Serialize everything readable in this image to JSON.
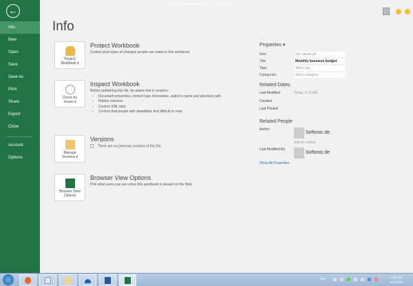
{
  "window": {
    "title": "Monthly business budget1 - Excel Preview"
  },
  "sidebar": {
    "items": [
      {
        "label": "Info",
        "selected": true
      },
      {
        "label": "New"
      },
      {
        "label": "Open"
      },
      {
        "label": "Save"
      },
      {
        "label": "Save As"
      },
      {
        "label": "Print"
      },
      {
        "label": "Share"
      },
      {
        "label": "Export"
      },
      {
        "label": "Close"
      }
    ],
    "bottom": [
      {
        "label": "Account"
      },
      {
        "label": "Options"
      }
    ]
  },
  "page_title": "Info",
  "sections": [
    {
      "button": [
        "Protect",
        "Workbook ▾"
      ],
      "icon": "lock-key-icon",
      "title": "Protect Workbook",
      "desc": "Control what types of changes people can make to this workbook."
    },
    {
      "button": [
        "Check for",
        "Issues ▾"
      ],
      "icon": "inspect-document-icon",
      "title": "Inspect Workbook",
      "desc": "Before publishing this file, be aware that it contains:",
      "bullets": [
        "Document properties, content type information, author's name and absolute path",
        "Hidden columns",
        "Custom XML data",
        "Content that people with disabilities find difficult to read"
      ]
    },
    {
      "button": [
        "Manage",
        "Versions ▾"
      ],
      "icon": "manage-versions-icon",
      "title": "Versions",
      "desc": "There are no previous versions of this file."
    },
    {
      "button": [
        "Browser View",
        "Options"
      ],
      "icon": "browser-view-icon",
      "title": "Browser View Options",
      "desc": "Pick what users can see when this workbook is viewed on the Web."
    }
  ],
  "properties": {
    "header": "Properties ▾",
    "rows": [
      {
        "k": "Size",
        "v": "Not saved yet"
      },
      {
        "k": "Title",
        "v": "Monthly business budget"
      },
      {
        "k": "Tags",
        "v": "Add a tag"
      },
      {
        "k": "Categories",
        "v": "Add a category"
      }
    ],
    "dates_header": "Related Dates",
    "dates": [
      {
        "k": "Last Modified",
        "v": "Today, 4:16 AM"
      },
      {
        "k": "Created",
        "v": ""
      },
      {
        "k": "Last Printed",
        "v": ""
      }
    ],
    "people_header": "Related People",
    "author_label": "Author",
    "author": "Softonic.de",
    "add_author": "Add an author",
    "modified_by_label": "Last Modified By",
    "modified_by": "Softonic.de",
    "show_all": "Show All Properties"
  },
  "taskbar": {
    "lang": "EN",
    "time": "4:36 AM",
    "date": "3/17/2015",
    "apps": [
      "firefox-icon",
      "notepad-icon",
      "file-explorer-icon",
      "onedrive-icon",
      "word-icon",
      "excel-icon"
    ]
  },
  "colors": {
    "accent": "#217346",
    "sidebar_selected": "#439467",
    "link": "#2b6cb8"
  }
}
